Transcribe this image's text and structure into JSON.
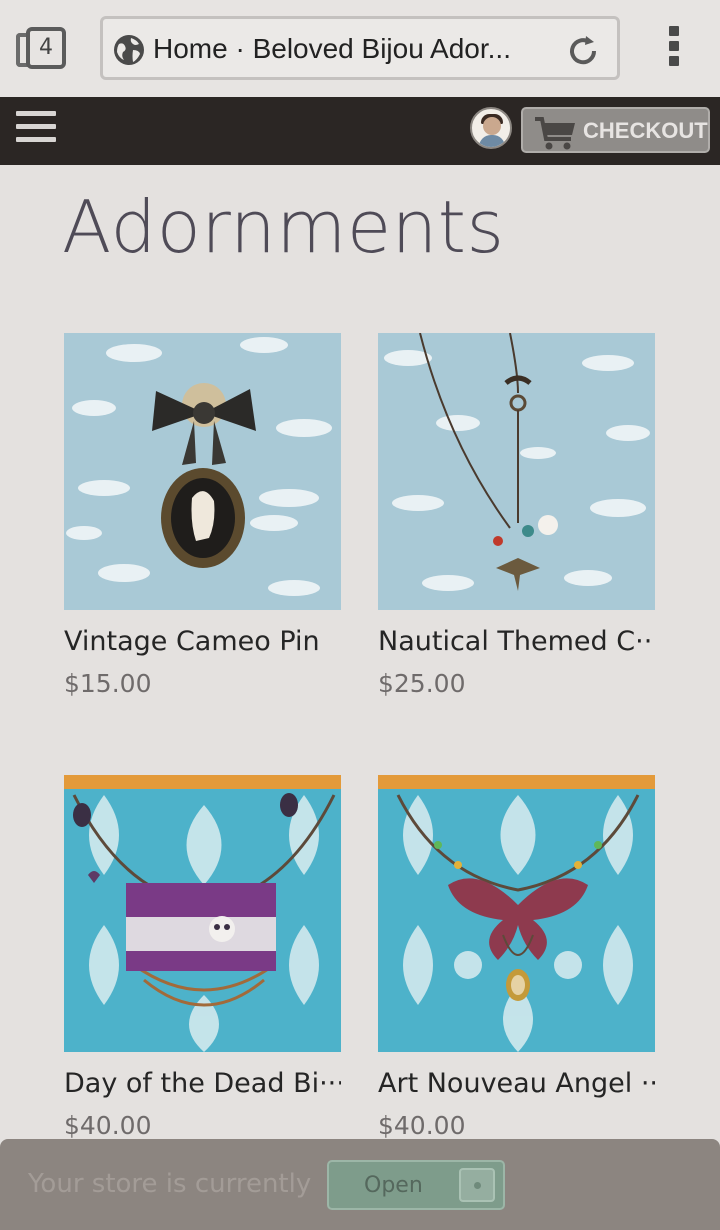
{
  "browser": {
    "tab_count": "4",
    "url_text": "Home · Beloved Bijou Ador..."
  },
  "header": {
    "checkout_label": "CHECKOUT"
  },
  "page": {
    "title": "Adornments"
  },
  "products": [
    {
      "name": "Vintage Cameo Pin",
      "price": "$15.00"
    },
    {
      "name": "Nautical Themed C···",
      "price": "$25.00"
    },
    {
      "name": "Day of the Dead Bi···",
      "price": "$40.00"
    },
    {
      "name": "Art Nouveau Angel ···",
      "price": "$40.00"
    }
  ],
  "store_banner": {
    "text": "Your store is currently",
    "toggle_label": "Open"
  },
  "colors": {
    "header_bg": "#2b2624",
    "page_bg": "#e4e1df",
    "title": "#4f4b57",
    "toggle_open": "#7e9c8b"
  }
}
